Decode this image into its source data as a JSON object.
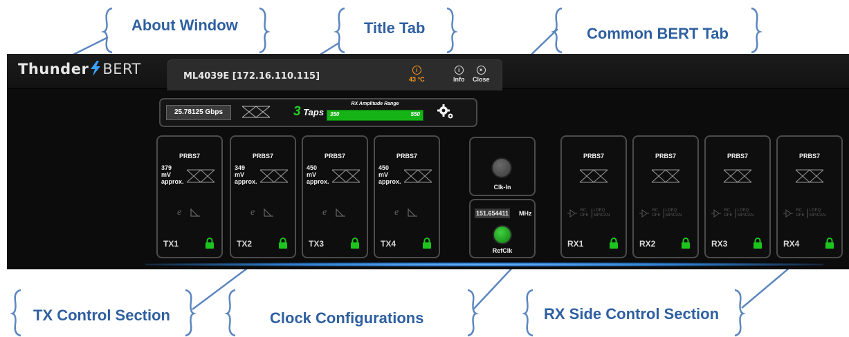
{
  "callouts": {
    "about_window": "About Window",
    "title_tab": "Title Tab",
    "common_bert_tab": "Common BERT Tab",
    "tx_control_section": "TX Control Section",
    "clock_configurations": "Clock Configurations",
    "rx_side_control_section": "RX Side Control Section"
  },
  "colors": {
    "callout_text": "#2e5fa0",
    "app_background": "#0c0c0c",
    "accent_green": "#16b316",
    "temperature_orange": "#ff9b1a"
  },
  "logo": {
    "part1": "Thunder",
    "part2": "BERT"
  },
  "title_tab": {
    "title": "ML4039E  [172.16.110.115]",
    "temperature": "43 °C",
    "info_label": "Info",
    "close_label": "Close"
  },
  "common": {
    "data_rate": "25.78125  Gbps",
    "taps_number": "3",
    "taps_label": "Taps",
    "rx_range_label": "RX Amplitude Range",
    "rx_range_min": "350",
    "rx_range_max": "550"
  },
  "tx": [
    {
      "name": "TX1",
      "pattern": "PRBS7",
      "amp_value": "379",
      "amp_unit": "mV",
      "amp_note": "approx."
    },
    {
      "name": "TX2",
      "pattern": "PRBS7",
      "amp_value": "349",
      "amp_unit": "mV",
      "amp_note": "approx."
    },
    {
      "name": "TX3",
      "pattern": "PRBS7",
      "amp_value": "450",
      "amp_unit": "mV",
      "amp_note": "approx."
    },
    {
      "name": "TX4",
      "pattern": "PRBS7",
      "amp_value": "450",
      "amp_unit": "mV",
      "amp_note": "approx."
    }
  ],
  "tx_pre_symbol": "e",
  "clock": {
    "clk_in_label": "Clk-In",
    "ref_frequency": "151.654411",
    "ref_unit": "MHz",
    "ref_label": "RefClk"
  },
  "rx": [
    {
      "name": "RX1",
      "pattern": "PRBS7"
    },
    {
      "name": "RX2",
      "pattern": "PRBS7"
    },
    {
      "name": "RX3",
      "pattern": "PRBS7"
    },
    {
      "name": "RX4",
      "pattern": "PRBS7"
    }
  ],
  "rx_eq": {
    "rc": "RC",
    "dfe": "DFE",
    "ldeq": "LDEQ",
    "mpican": "MPICAN"
  },
  "icons": [
    "lightning-bolt-icon",
    "info-icon",
    "close-icon",
    "gear-icon",
    "eye-diagram-icon",
    "step-response-icon",
    "buffer-icon",
    "lock-icon"
  ]
}
